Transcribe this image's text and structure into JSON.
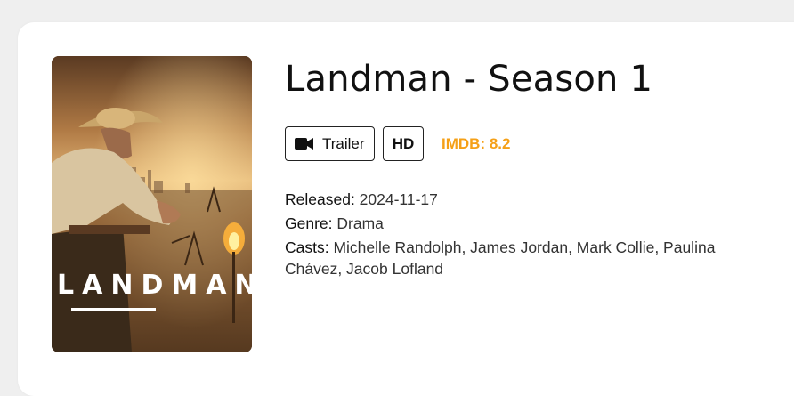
{
  "movie": {
    "title": "Landman - Season 1",
    "poster_logo": "LANDMAN",
    "trailer_label": "Trailer",
    "trailer_icon": "video-camera-icon",
    "quality_badge": "HD",
    "imdb": "IMDB: 8.2",
    "imdb_color": "#f5a017",
    "released_label": "Released:",
    "released_value": "2024-11-17",
    "genre_label": "Genre:",
    "genre_value": "Drama",
    "casts_label": "Casts:",
    "casts_value": "Michelle Randolph, James Jordan, Mark Collie, Paulina Chávez, Jacob Lofland"
  }
}
